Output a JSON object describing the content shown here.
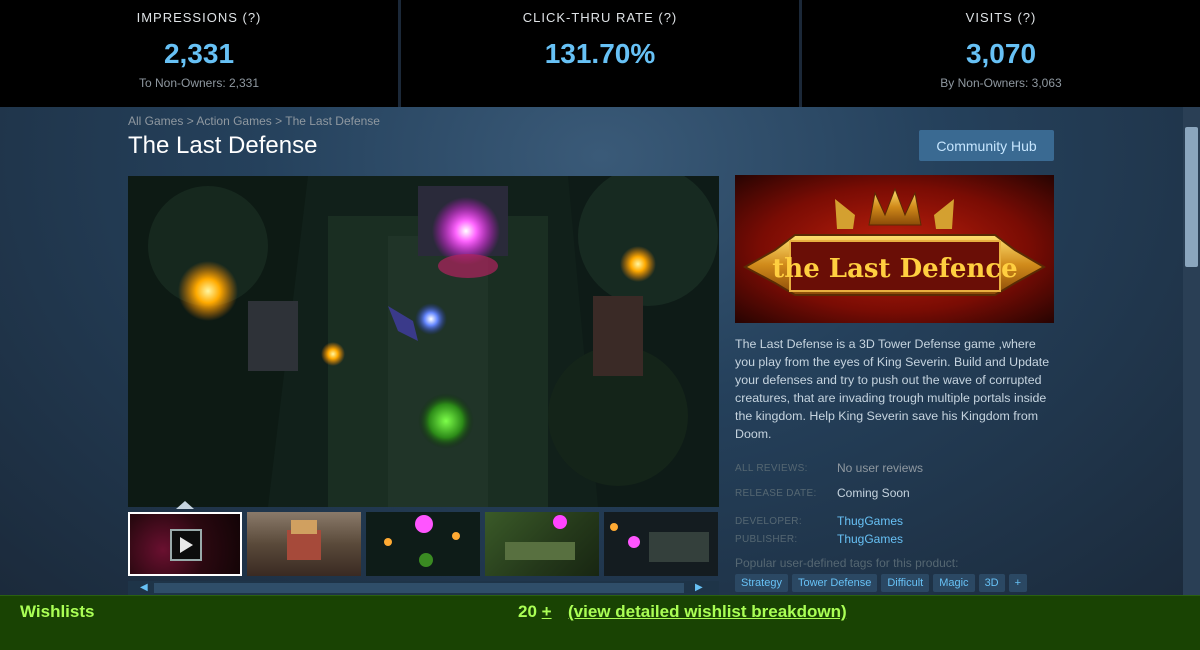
{
  "stats": [
    {
      "label": "IMPRESSIONS (?)",
      "value": "2,331",
      "sub": "To Non-Owners: 2,331"
    },
    {
      "label": "CLICK-THRU RATE (?)",
      "value": "131.70%",
      "sub": ""
    },
    {
      "label": "VISITS (?)",
      "value": "3,070",
      "sub": "By Non-Owners: 3,063"
    }
  ],
  "breadcrumb": {
    "items": [
      "All Games",
      "Action Games",
      "The Last Defense"
    ],
    "separator": ">"
  },
  "game": {
    "title": "The Last Defense",
    "community_hub": "Community Hub",
    "capsule_logo": "the Last Defence",
    "description": "The Last Defense is a 3D Tower Defense game ,where you play from the eyes of King Severin. Build and Update your defenses and try to push out the wave of corrupted creatures, that are invading trough multiple portals inside the kingdom. Help King Severin save his Kingdom from Doom.",
    "reviews_label": "ALL REVIEWS:",
    "reviews_value": "No user reviews",
    "release_label": "RELEASE DATE:",
    "release_value": "Coming Soon",
    "developer_label": "DEVELOPER:",
    "developer_value": "ThugGames",
    "publisher_label": "PUBLISHER:",
    "publisher_value": "ThugGames",
    "tags_label": "Popular user-defined tags for this product:",
    "tags": [
      "Strategy",
      "Tower Defense",
      "Difficult",
      "Magic",
      "3D",
      "+"
    ]
  },
  "media": {
    "thumb_count": 5,
    "play_icon": "play-icon"
  },
  "wishlist": {
    "label": "Wishlists",
    "count": "20",
    "plus": "+",
    "link": "(view detailed wishlist breakdown)"
  },
  "colors": {
    "accent": "#67c1f5",
    "wishlist_green": "#aaff55",
    "wishlist_bg": "#194303"
  }
}
